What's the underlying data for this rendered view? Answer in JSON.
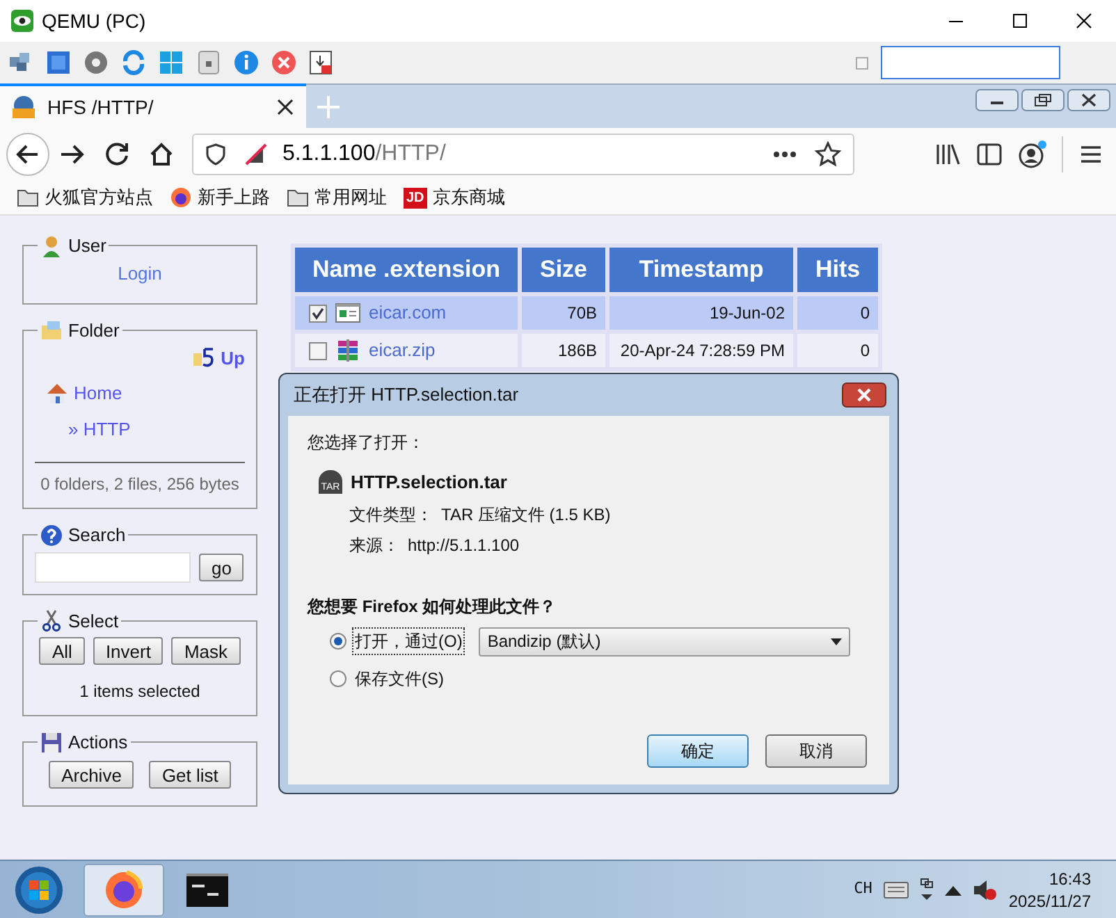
{
  "qemu_window": {
    "title": "QEMU (PC)"
  },
  "qemu_toolbar": {
    "checkbox_checked": false
  },
  "browser": {
    "tab": {
      "title": "HFS /HTTP/",
      "selected": true
    },
    "address": {
      "host": "5.1.1.100",
      "path": "/HTTP/"
    },
    "bookmarks": [
      {
        "label": "火狐官方站点",
        "kind": "folder"
      },
      {
        "label": "新手上路",
        "kind": "firefox"
      },
      {
        "label": "常用网址",
        "kind": "folder"
      },
      {
        "label": "京东商城",
        "kind": "jd",
        "icon_text": "JD"
      }
    ]
  },
  "sidebar": {
    "user": {
      "title": "User",
      "link": "Login"
    },
    "folder": {
      "title": "Folder",
      "up": "Up",
      "home": "Home",
      "path": "» HTTP",
      "summary": "0 folders, 2 files, 256 bytes"
    },
    "search": {
      "title": "Search",
      "button": "go"
    },
    "select": {
      "title": "Select",
      "buttons": [
        "All",
        "Invert",
        "Mask"
      ],
      "status": "1 items selected"
    },
    "actions": {
      "title": "Actions",
      "buttons": [
        "Archive",
        "Get list"
      ]
    }
  },
  "file_table": {
    "columns": [
      "Name .extension",
      "Size",
      "Timestamp",
      "Hits"
    ],
    "rows": [
      {
        "kind": "app",
        "name": "eicar.com",
        "size": "70B",
        "timestamp": "19-Jun-02",
        "hits": "0",
        "checked": true
      },
      {
        "kind": "archive",
        "name": "eicar.zip",
        "size": "186B",
        "timestamp": "20-Apr-24 7:28:59 PM",
        "hits": "0",
        "checked": false
      }
    ]
  },
  "dialog": {
    "title": "正在打开 HTTP.selection.tar",
    "intro": "您选择了打开：",
    "file_name": "HTTP.selection.tar",
    "file_icon_text": "TAR",
    "type_label": "文件类型：",
    "type_value": "TAR 压缩文件 (1.5 KB)",
    "source_label": "来源：",
    "source_value": "http://5.1.1.100",
    "question": "您想要 Firefox 如何处理此文件？",
    "options": [
      {
        "kind": "open",
        "label": "打开，通过(O)",
        "selected": true
      },
      {
        "kind": "save",
        "label": "保存文件(S)",
        "selected": false
      }
    ],
    "app_dropdown": "Bandizip (默认)",
    "buttons": [
      {
        "label": "确定",
        "default": true
      },
      {
        "label": "取消",
        "default": false
      }
    ]
  },
  "taskbar": {
    "apps": [
      {
        "kind": "firefox",
        "active": true
      },
      {
        "kind": "terminal",
        "active": false
      }
    ],
    "ime": "CH",
    "time": "16:43",
    "date": "2025/11/27"
  }
}
